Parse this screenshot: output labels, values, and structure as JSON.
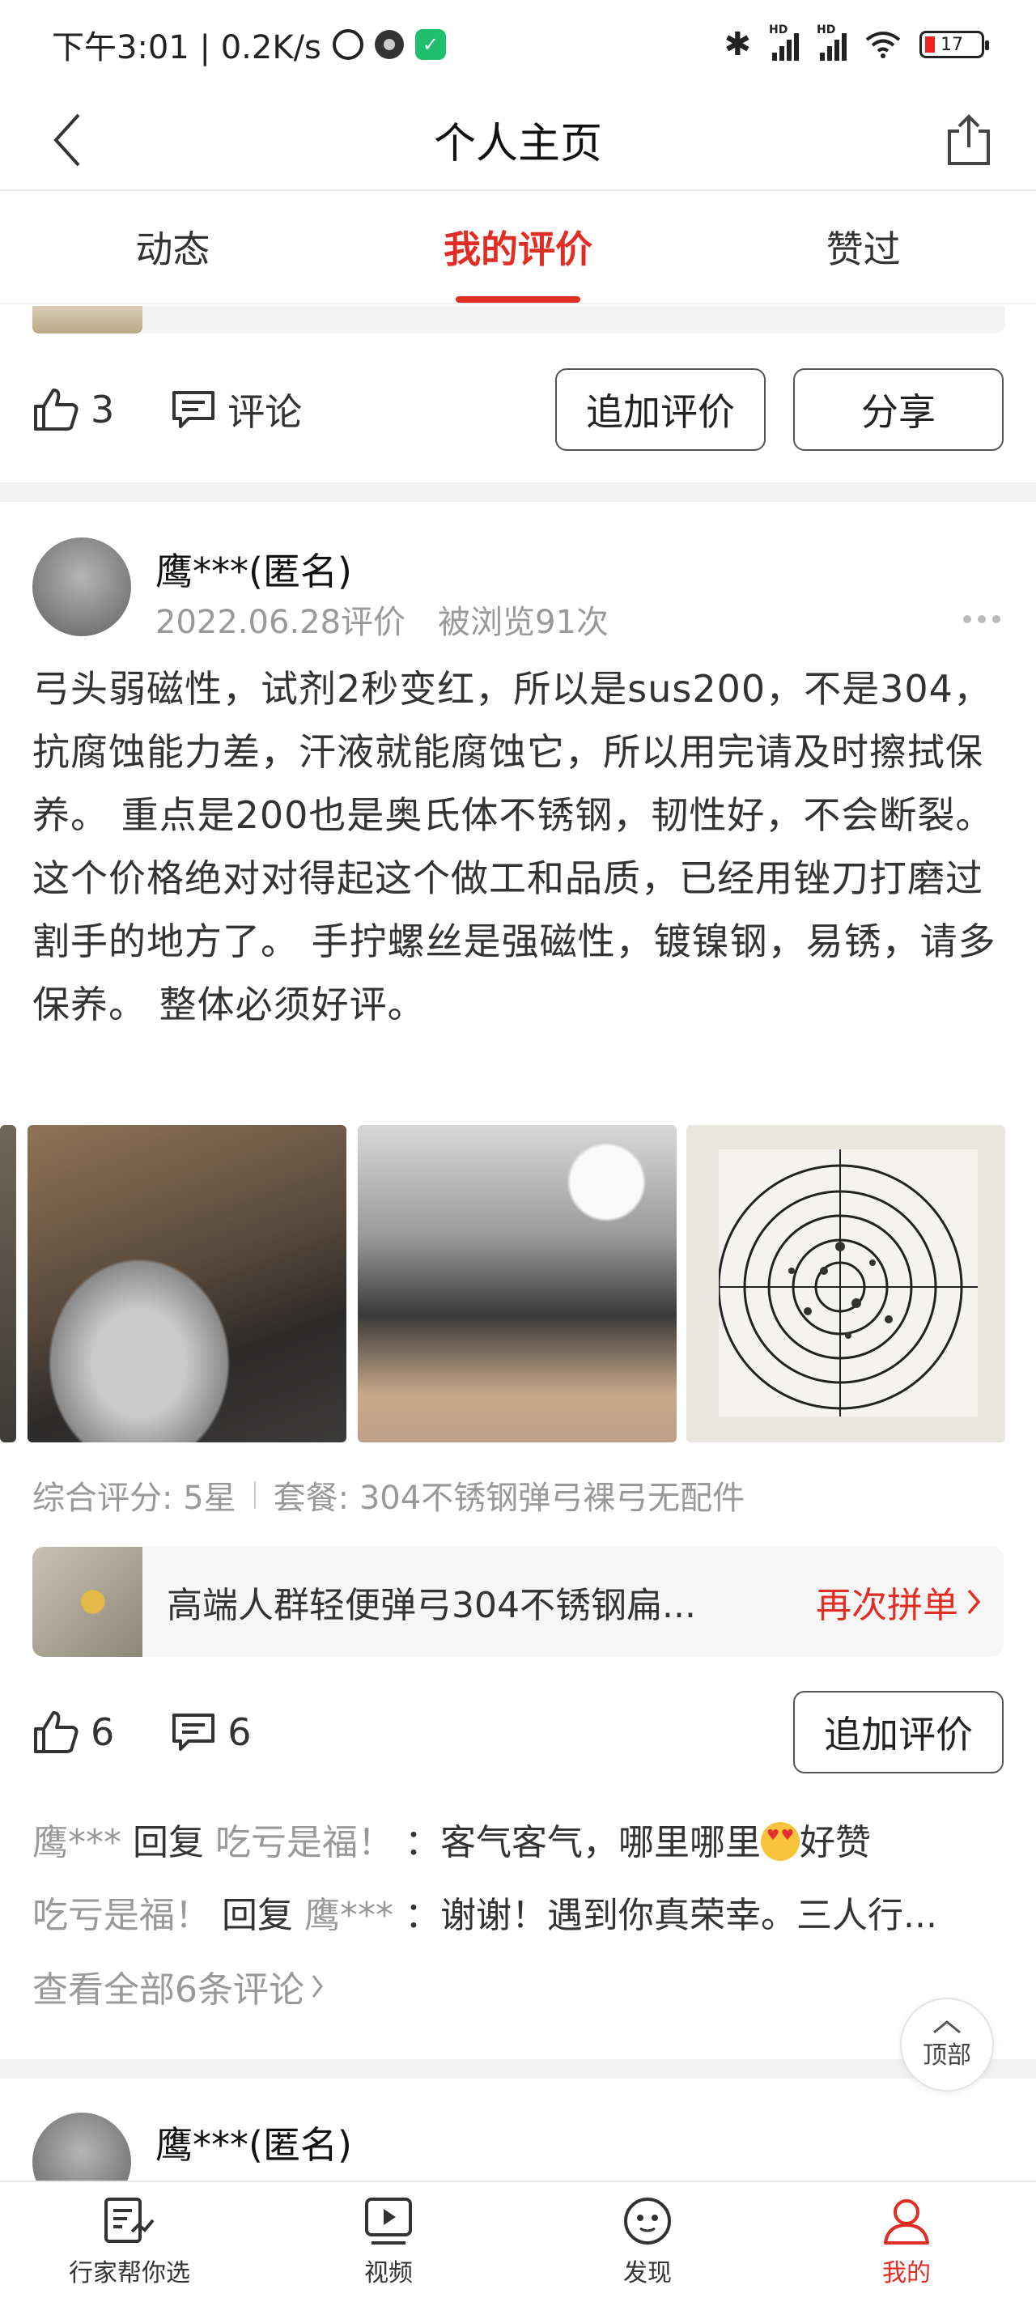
{
  "status_bar": {
    "time_speed": "下午3:01 | 0.2K/s",
    "battery": "17",
    "hd": "HD"
  },
  "header": {
    "title": "个人主页"
  },
  "tabs": [
    {
      "label": "动态",
      "active": false
    },
    {
      "label": "我的评价",
      "active": true
    },
    {
      "label": "赞过",
      "active": false
    }
  ],
  "prev_review": {
    "likes": "3",
    "comment_label": "评论",
    "add_review_label": "追加评价",
    "share_label": "分享"
  },
  "review": {
    "user": "鹰***(匿名)",
    "date": "2022.06.28评价",
    "views": "被浏览91次",
    "text": "弓头弱磁性，试剂2秒变红，所以是sus200，不是304，抗腐蚀能力差，汗液就能腐蚀它，所以用完请及时擦拭保养。 重点是200也是奥氏体不锈钢，韧性好，不会断裂。 这个价格绝对对得起这个做工和品质，已经用锉刀打磨过割手的地方了。 手拧螺丝是强磁性，镀镍钢，易锈，请多保养。 整体必须好评。",
    "rating": "综合评分: 5星",
    "package": "套餐: 304不锈钢弹弓裸弓无配件",
    "product_title": "高端人群轻便弹弓304不锈钢扁...",
    "product_cta": "再次拼单",
    "likes": "6",
    "comments": "6",
    "add_review_label": "追加评价",
    "replies": [
      {
        "from": "鹰***",
        "verb": "回复",
        "to": "吃亏是福！",
        "text": "：客气客气，哪里哪里",
        "suffix": "好赞"
      },
      {
        "from": "吃亏是福！",
        "verb": "回复",
        "to": "鹰***",
        "text": "：谢谢！遇到你真荣幸。三人行..."
      }
    ],
    "view_all": "查看全部6条评论"
  },
  "next_review": {
    "user": "鹰***(匿名)"
  },
  "top_button": "顶部",
  "bottom_nav": [
    {
      "label": "行家帮你选",
      "icon": "checklist-icon",
      "active": false
    },
    {
      "label": "视频",
      "icon": "video-icon",
      "active": false
    },
    {
      "label": "发现",
      "icon": "discover-icon",
      "active": false
    },
    {
      "label": "我的",
      "icon": "person-icon",
      "active": true
    }
  ],
  "colors": {
    "accent": "#e02e24"
  }
}
